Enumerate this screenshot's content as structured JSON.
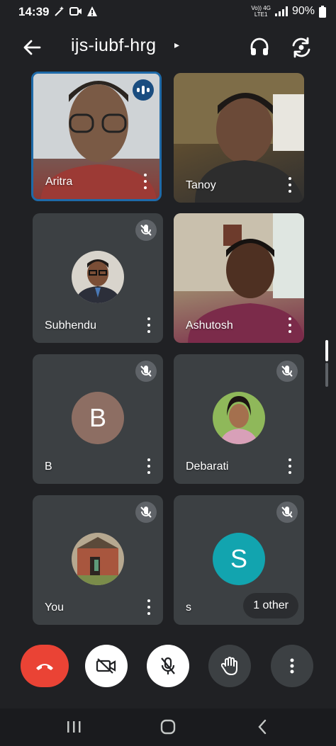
{
  "status_bar": {
    "time": "14:39",
    "network_top": "Vo)) 4G",
    "network_bottom": "LTE1",
    "battery": "90%"
  },
  "app_bar": {
    "meeting_code": "ijs-iubf-hrg",
    "caret": "▸"
  },
  "participants": [
    {
      "name": "Aritra",
      "state": "speaking",
      "view": "video"
    },
    {
      "name": "Tanoy",
      "state": "unmuted",
      "view": "video"
    },
    {
      "name": "Subhendu",
      "state": "muted",
      "view": "avatar-photo"
    },
    {
      "name": "Ashutosh",
      "state": "unmuted",
      "view": "video"
    },
    {
      "name": "B",
      "state": "muted",
      "view": "avatar-letter",
      "avatar_letter": "B",
      "avatar_color": "#8d6e63"
    },
    {
      "name": "Debarati",
      "state": "muted",
      "view": "avatar-photo"
    },
    {
      "name": "You",
      "state": "muted",
      "view": "avatar-photo"
    },
    {
      "name": "s",
      "state": "muted",
      "view": "avatar-letter",
      "avatar_letter": "S",
      "avatar_color": "#12a4af"
    }
  ],
  "other_pill": "1 other",
  "colors": {
    "background": "#202124",
    "tile": "#3c4043",
    "end_call": "#ea4335",
    "speaking_border": "#1e6aa8"
  },
  "controls": [
    "end-call",
    "camera-off",
    "mic-off",
    "raise-hand",
    "more-options"
  ]
}
